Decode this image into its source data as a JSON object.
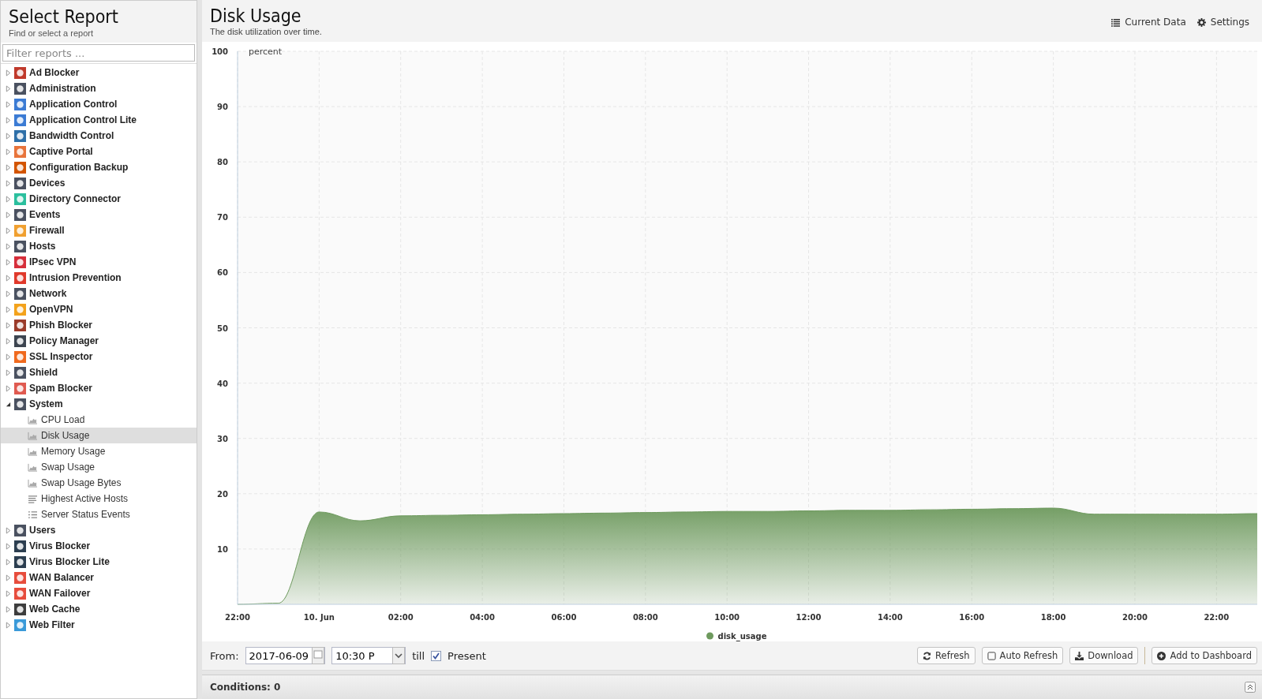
{
  "sidebar": {
    "title": "Select Report",
    "subtitle": "Find or select a report",
    "filter": {
      "placeholder": "Filter reports ..."
    },
    "items": [
      {
        "label": "Ad Blocker",
        "color": "#c0392b",
        "expanded": false
      },
      {
        "label": "Administration",
        "color": "#4a5160",
        "expanded": false
      },
      {
        "label": "Application Control",
        "color": "#3b7bd4",
        "expanded": false
      },
      {
        "label": "Application Control Lite",
        "color": "#3b7bd4",
        "expanded": false
      },
      {
        "label": "Bandwidth Control",
        "color": "#2e6fa8",
        "expanded": false
      },
      {
        "label": "Captive Portal",
        "color": "#e8743b",
        "expanded": false
      },
      {
        "label": "Configuration Backup",
        "color": "#d35400",
        "expanded": false
      },
      {
        "label": "Devices",
        "color": "#4a5160",
        "expanded": false
      },
      {
        "label": "Directory Connector",
        "color": "#2bbf9e",
        "expanded": false
      },
      {
        "label": "Events",
        "color": "#4a5160",
        "expanded": false
      },
      {
        "label": "Firewall",
        "color": "#f0a030",
        "expanded": false
      },
      {
        "label": "Hosts",
        "color": "#4a5160",
        "expanded": false
      },
      {
        "label": "IPsec VPN",
        "color": "#d62e3a",
        "expanded": false
      },
      {
        "label": "Intrusion Prevention",
        "color": "#e0392b",
        "expanded": false
      },
      {
        "label": "Network",
        "color": "#4a5160",
        "expanded": false
      },
      {
        "label": "OpenVPN",
        "color": "#f3a21b",
        "expanded": false
      },
      {
        "label": "Phish Blocker",
        "color": "#9b3b2a",
        "expanded": false
      },
      {
        "label": "Policy Manager",
        "color": "#3d4550",
        "expanded": false
      },
      {
        "label": "SSL Inspector",
        "color": "#f06a1e",
        "expanded": false
      },
      {
        "label": "Shield",
        "color": "#4a5160",
        "expanded": false
      },
      {
        "label": "Spam Blocker",
        "color": "#e05a50",
        "expanded": false
      },
      {
        "label": "System",
        "color": "#4a5160",
        "expanded": true,
        "children": [
          {
            "label": "CPU Load",
            "kind": "area",
            "selected": false
          },
          {
            "label": "Disk Usage",
            "kind": "area",
            "selected": true
          },
          {
            "label": "Memory Usage",
            "kind": "area",
            "selected": false
          },
          {
            "label": "Swap Usage",
            "kind": "area",
            "selected": false
          },
          {
            "label": "Swap Usage Bytes",
            "kind": "area",
            "selected": false
          },
          {
            "label": "Highest Active Hosts",
            "kind": "bars",
            "selected": false
          },
          {
            "label": "Server Status Events",
            "kind": "list",
            "selected": false
          }
        ]
      },
      {
        "label": "Users",
        "color": "#4a5160",
        "expanded": false
      },
      {
        "label": "Virus Blocker",
        "color": "#2c3e50",
        "expanded": false
      },
      {
        "label": "Virus Blocker Lite",
        "color": "#2c3e50",
        "expanded": false
      },
      {
        "label": "WAN Balancer",
        "color": "#e74c3c",
        "expanded": false
      },
      {
        "label": "WAN Failover",
        "color": "#e74c3c",
        "expanded": false
      },
      {
        "label": "Web Cache",
        "color": "#3d3d3d",
        "expanded": false
      },
      {
        "label": "Web Filter",
        "color": "#3a9ad9",
        "expanded": false
      }
    ]
  },
  "report": {
    "title": "Disk Usage",
    "subtitle": "The disk utilization over time.",
    "actions": [
      "Current Data",
      "Settings"
    ],
    "chart_data": {
      "type": "area",
      "ylabel": "percent",
      "categories": [
        "22:00",
        null,
        "10. Jun",
        null,
        "02:00",
        null,
        "04:00",
        null,
        "06:00",
        null,
        "08:00",
        null,
        "10:00",
        null,
        "12:00",
        null,
        "14:00",
        null,
        "16:00",
        null,
        "18:00",
        null,
        "20:00",
        null,
        "22:00",
        null
      ],
      "series": [
        {
          "name": "disk_usage",
          "color": "#6e9a5e",
          "values": [
            0,
            0.2,
            16.7,
            15.1,
            16.0,
            16.1,
            16.2,
            16.3,
            16.4,
            16.5,
            16.6,
            16.7,
            16.8,
            16.8,
            16.9,
            17.0,
            17.0,
            17.1,
            17.2,
            17.3,
            17.4,
            16.3,
            16.3,
            16.3,
            16.3,
            16.4
          ]
        }
      ],
      "ylim": [
        0,
        100
      ],
      "grid": true,
      "yticks": [
        10,
        20,
        30,
        40,
        50,
        60,
        70,
        80,
        90,
        100
      ]
    }
  },
  "toolbar": {
    "from_label": "From:",
    "date": "2017-06-09",
    "time": "10:30 P",
    "till_label": "till",
    "present": {
      "label": "Present",
      "checked": true
    },
    "buttons": [
      {
        "label": "Refresh",
        "kind": "refresh"
      },
      {
        "label": "Auto Refresh",
        "kind": "checkbox"
      },
      {
        "label": "Download",
        "kind": "download"
      },
      {
        "label": "Add to Dashboard",
        "kind": "add"
      }
    ]
  },
  "conditions": "Conditions: 0"
}
